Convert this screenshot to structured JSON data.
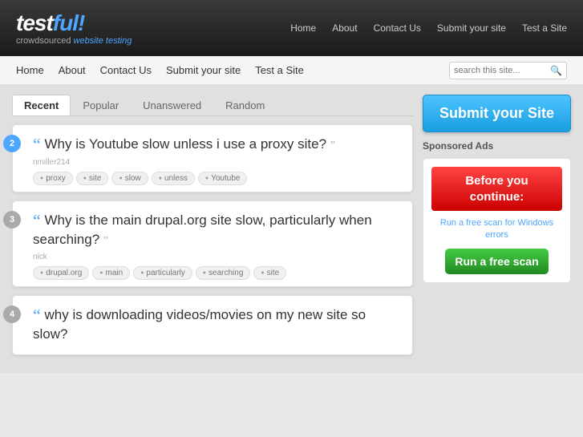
{
  "topBar": {
    "logo": "testful!",
    "logoAccent": "ful",
    "logoBang": "!",
    "logoSub": "crowdsourced",
    "logoSubAccent": "website testing",
    "nav": [
      {
        "label": "Home",
        "href": "#"
      },
      {
        "label": "About",
        "href": "#"
      },
      {
        "label": "Contact Us",
        "href": "#"
      },
      {
        "label": "Submit your site",
        "href": "#"
      },
      {
        "label": "Test a Site",
        "href": "#"
      }
    ]
  },
  "secNav": {
    "links": [
      {
        "label": "Home"
      },
      {
        "label": "About"
      },
      {
        "label": "Contact Us"
      },
      {
        "label": "Submit your site"
      },
      {
        "label": "Test a Site"
      }
    ],
    "searchPlaceholder": "search this site..."
  },
  "tabs": [
    {
      "label": "Recent",
      "active": true
    },
    {
      "label": "Popular",
      "active": false
    },
    {
      "label": "Unanswered",
      "active": false
    },
    {
      "label": "Random",
      "active": false
    }
  ],
  "questions": [
    {
      "number": "2",
      "text": "Why is Youtube slow unless i use a proxy site?",
      "author": "nmiller214",
      "tags": [
        "proxy",
        "site",
        "slow",
        "unless",
        "Youtube"
      ]
    },
    {
      "number": "3",
      "text": "Why is the main drupal.org site slow, particularly when searching?",
      "author": "nick",
      "tags": [
        "drupal.org",
        "main",
        "particularly",
        "searching",
        "site"
      ]
    },
    {
      "number": "4",
      "text": "why is downloading videos/movies on my new site so slow?",
      "author": "",
      "tags": []
    }
  ],
  "rightCol": {
    "submitLabel": "Submit your Site",
    "sponsoredLabel": "Sponsored Ads",
    "adBefore": "Before you continue:",
    "adText": "Run a free scan for Windows errors",
    "adScanBtn": "Run a free scan"
  }
}
